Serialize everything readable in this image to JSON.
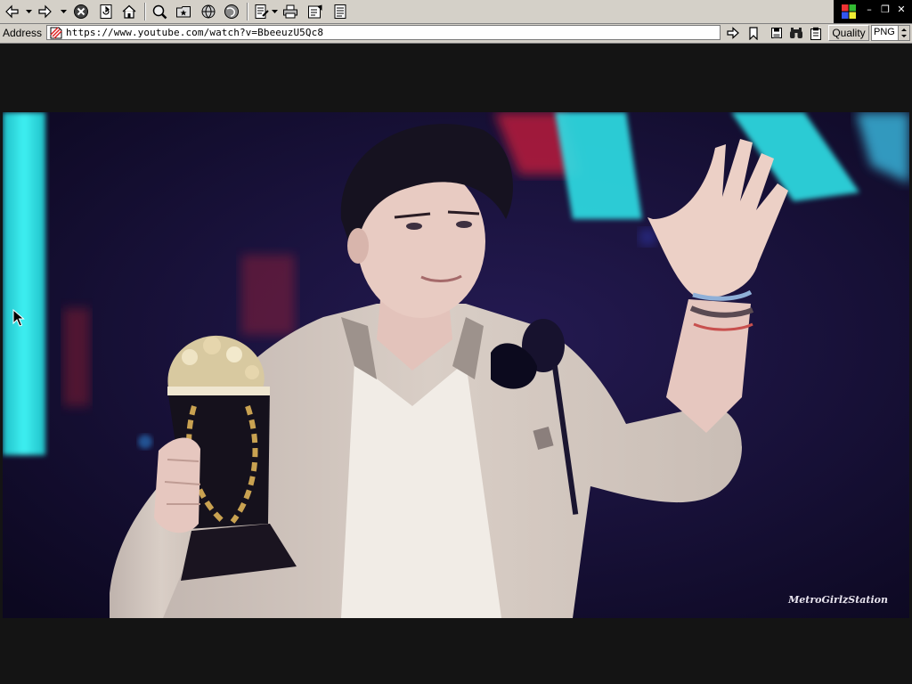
{
  "toolbar": {
    "buttons": [
      "back",
      "forward",
      "stop",
      "refresh",
      "home",
      "search",
      "favorites",
      "history",
      "channels",
      "edit",
      "print",
      "discuss",
      "page"
    ]
  },
  "window": {
    "controls": [
      "minimize",
      "restore",
      "close"
    ]
  },
  "address": {
    "label": "Address",
    "url": "https://www.youtube.com/watch?v=BbeeuzU5Qc8"
  },
  "quality": {
    "label": "Quality",
    "format": "PNG"
  },
  "video": {
    "watermark": "MetroGirlzStation"
  },
  "colors": {
    "chrome": "#d4d0c8",
    "letterbox": "#141414",
    "stage_deep": "#120c2a",
    "cyan_light": "#2ee6e6",
    "red_light": "#b0243a"
  }
}
